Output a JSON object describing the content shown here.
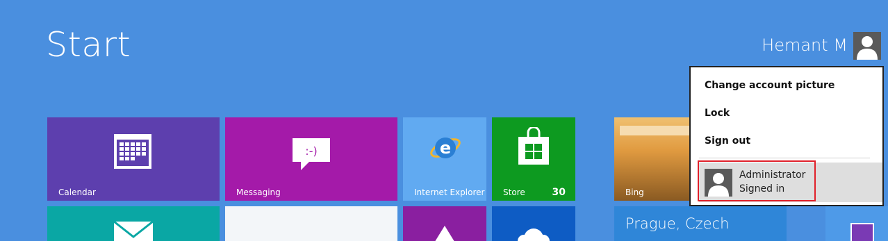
{
  "start": {
    "title": "Start"
  },
  "user": {
    "name": "Hemant M"
  },
  "account_menu": {
    "items": [
      "Change account picture",
      "Lock",
      "Sign out"
    ],
    "other_account": {
      "name": "Administrator",
      "status": "Signed in"
    }
  },
  "tiles": {
    "calendar": {
      "label": "Calendar",
      "icon": "calendar-icon",
      "color": "#5d3fae"
    },
    "messaging": {
      "label": "Messaging",
      "icon": "messaging-icon",
      "color": "#a41aa9"
    },
    "ie": {
      "label": "Internet Explorer",
      "icon": "internet-explorer-icon",
      "color": "#61aaf1"
    },
    "store": {
      "label": "Store",
      "badge": "30",
      "icon": "store-icon",
      "color": "#0d9a20"
    },
    "bing": {
      "label": "Bing",
      "color": "#b58a3a"
    },
    "weather": {
      "city": "Prague, Czech",
      "color": "#2f86d8"
    }
  },
  "colors": {
    "background": "#4a8fdf",
    "highlight_border": "#e0202a"
  }
}
